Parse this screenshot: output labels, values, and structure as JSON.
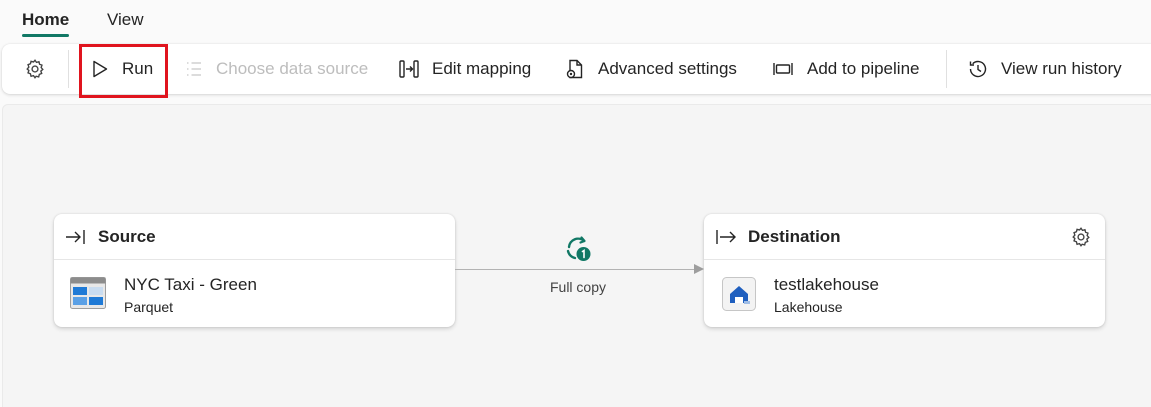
{
  "tabs": [
    {
      "label": "Home",
      "active": true
    },
    {
      "label": "View",
      "active": false
    }
  ],
  "toolbar": {
    "settings_icon": "gear-icon",
    "run_label": "Run",
    "choose_data_source_label": "Choose data source",
    "edit_mapping_label": "Edit mapping",
    "advanced_settings_label": "Advanced settings",
    "add_to_pipeline_label": "Add to pipeline",
    "view_run_history_label": "View run history"
  },
  "source": {
    "header": "Source",
    "name": "NYC Taxi - Green",
    "type": "Parquet",
    "icon": "table-file-icon"
  },
  "connection": {
    "label": "Full copy",
    "icon": "copy-cycle-icon"
  },
  "destination": {
    "header": "Destination",
    "name": "testlakehouse",
    "type": "Lakehouse",
    "icon": "lakehouse-icon"
  },
  "colors": {
    "accent": "#117865",
    "highlight": "#e0141e",
    "disabled_text": "#bdbdbd"
  }
}
